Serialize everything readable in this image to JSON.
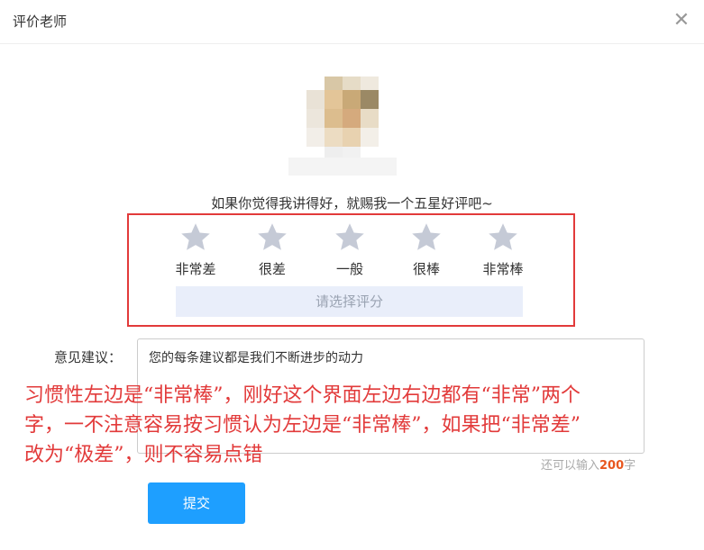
{
  "dialog": {
    "title": "评价老师",
    "close_icon": "close-icon"
  },
  "prompt": "如果你觉得我讲得好，就赐我一个五星好评吧~",
  "rating": {
    "star_icon": "star-icon",
    "star_color": "#c5cad6",
    "options": [
      "非常差",
      "很差",
      "一般",
      "很棒",
      "非常棒"
    ],
    "score_placeholder": "请选择评分"
  },
  "suggestion": {
    "label": "意见建议：",
    "placeholder": "您的每条建议都是我们不断进步的动力",
    "counter_prefix": "还可以输入",
    "counter_num": "200",
    "counter_suffix": "字"
  },
  "submit_label": "提交",
  "annotation": {
    "line1": "习惯性左边是“非常棒”，刚好这个界面左边右边都有“非常”两个",
    "line2": "字，一不注意容易按习惯认为左边是“非常棒”，如果把“非常差”",
    "line3": "改为“极差”，则不容易点错",
    "color": "#e23a3a"
  },
  "colors": {
    "accent": "#1e9fff",
    "highlight_border": "#e23a3a",
    "counter_number": "#e8571f"
  }
}
